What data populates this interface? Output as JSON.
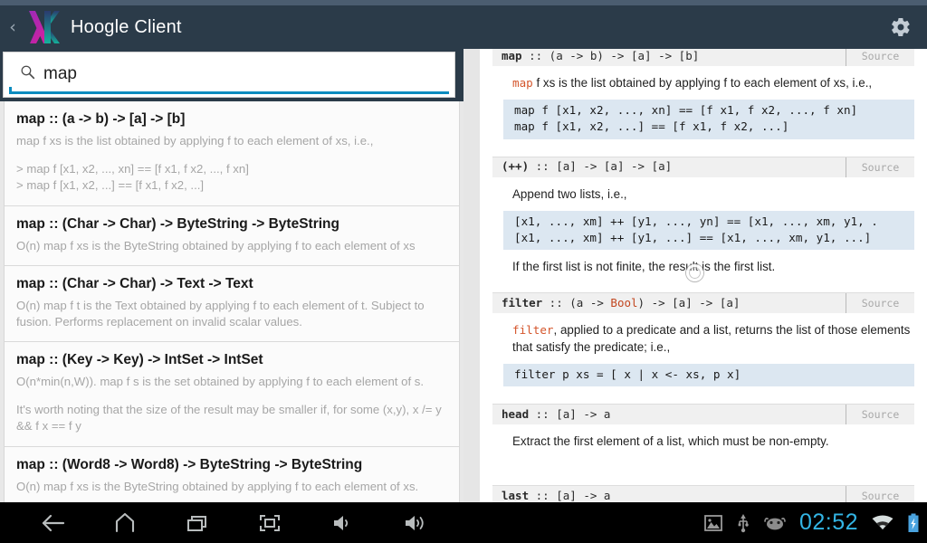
{
  "app": {
    "title": "Hoogle Client",
    "up_caret": "‹",
    "logo_name": "haskell-lambda-logo",
    "settings_label": "Settings"
  },
  "search": {
    "value": "map",
    "placeholder": "Search",
    "icon": "search-icon"
  },
  "results": [
    {
      "title": "map :: (a -> b) -> [a] -> [b]",
      "desc": "map f xs is the list obtained by applying f to each element of xs, i.e.,",
      "pre": "> map f [x1, x2, ..., xn] == [f x1, f x2, ..., f xn]\n> map f [x1, x2, ...] == [f x1, f x2, ...]"
    },
    {
      "title": "map :: (Char -> Char) -> ByteString -> ByteString",
      "desc": "O(n) map f xs is the ByteString obtained by applying f to each element of xs",
      "pre": ""
    },
    {
      "title": "map :: (Char -> Char) -> Text -> Text",
      "desc": "O(n) map f t is the Text obtained by applying f to each element of t. Subject to fusion. Performs replacement on invalid scalar values.",
      "pre": ""
    },
    {
      "title": "map :: (Key -> Key) -> IntSet -> IntSet",
      "desc": "O(n*min(n,W)). map f s is the set obtained by applying f to each element of s.",
      "desc2": "It's worth noting that the size of the result may be smaller if, for some (x,y), x /= y && f x == f y",
      "pre": ""
    },
    {
      "title": "map :: (Word8 -> Word8) -> ByteString -> ByteString",
      "desc": "O(n) map f xs is the ByteString obtained by applying f to each element of xs.",
      "pre": ""
    }
  ],
  "doc": {
    "source_label": "Source",
    "entries": [
      {
        "name": "map",
        "sig_rest": " :: (a -> b) -> [a] -> [b]",
        "para_ident": "map",
        "para_rest": " f  xs is the list obtained by applying f to each element of xs, i.e.,",
        "code": "map f [x1, x2, ..., xn] == [f x1, f x2, ..., f xn]\nmap f [x1, x2, ...] == [f x1, f x2, ...]",
        "para2": ""
      },
      {
        "name": "(++)",
        "sig_rest": " :: [a] -> [a] -> [a]",
        "para_ident": "",
        "para_rest": "Append two lists, i.e.,",
        "code": "[x1, ..., xm] ++ [y1, ..., yn] == [x1, ..., xm, y1, .\n[x1, ..., xm] ++ [y1, ...] == [x1, ..., xm, y1, ...]",
        "para2": "If the first list is not finite, the result is the first list."
      },
      {
        "name": "filter",
        "sig_rest": " :: (a -> Bool) -> [a] -> [a]",
        "sig_kw": "Bool",
        "para_ident": "filter",
        "para_rest": ", applied to a predicate and a list, returns the list of those elements that satisfy the predicate; i.e.,",
        "code": "filter p xs = [ x | x <- xs, p x]",
        "para2": ""
      },
      {
        "name": "head",
        "sig_rest": " :: [a] -> a",
        "para_ident": "",
        "para_rest": "Extract the first element of a list, which must be non-empty.",
        "code": "",
        "para2": ""
      },
      {
        "name": "last",
        "sig_rest": " :: [a] -> a",
        "para_ident": "",
        "para_rest": "",
        "code": "",
        "para2": ""
      }
    ]
  },
  "systembar": {
    "nav": [
      {
        "name": "back-icon",
        "label": "Back"
      },
      {
        "name": "home-icon",
        "label": "Home"
      },
      {
        "name": "recents-icon",
        "label": "Recent apps"
      },
      {
        "name": "fullscreen-icon",
        "label": "Expand"
      },
      {
        "name": "volume-down-icon",
        "label": "Volume down"
      },
      {
        "name": "volume-up-icon",
        "label": "Volume up"
      }
    ],
    "status": {
      "screenshot_icon": "screenshot-icon",
      "usb_icon": "usb-icon",
      "android_icon": "android-head-icon",
      "time": "02:52",
      "wifi_icon": "wifi-icon",
      "battery_icon": "battery-charging-icon"
    }
  },
  "colors": {
    "action_bar": "#2b3b49",
    "accent": "#0b8bbf",
    "clock": "#33b5e5",
    "code_bg": "#dce7f1",
    "identifier": "#d4552b",
    "logo_magenta": "#c0219b",
    "logo_teal": "#1aa79a"
  }
}
